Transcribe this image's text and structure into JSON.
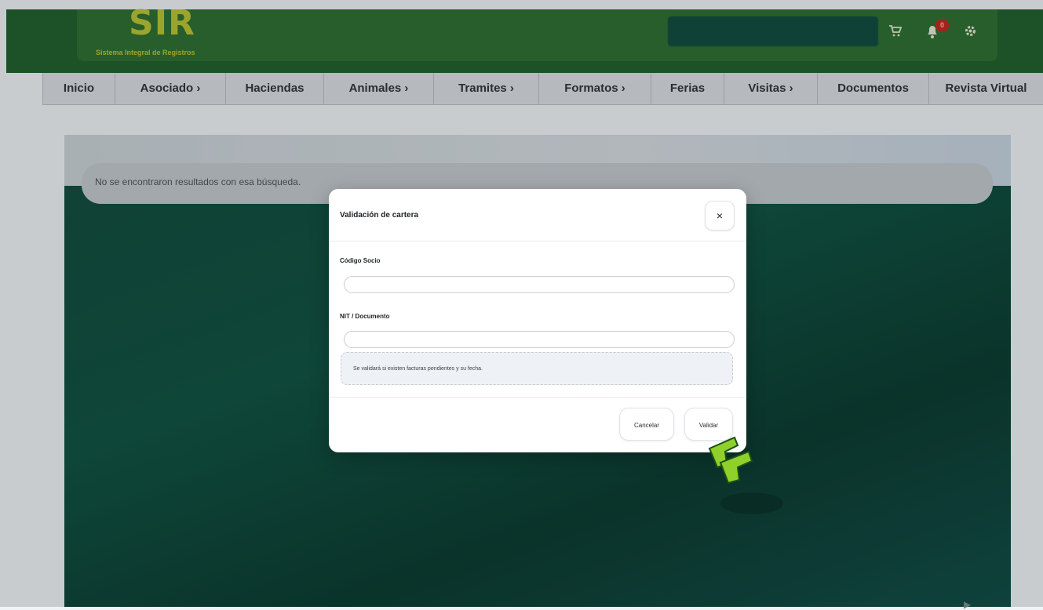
{
  "header": {
    "logo_title": "SIR",
    "logo_subtitle": "Sistema Integral de Registros",
    "notification_count": "0",
    "icons": [
      "cart-icon",
      "bell-icon",
      "gear-icon"
    ]
  },
  "nav": {
    "items": [
      {
        "label": "Inicio"
      },
      {
        "label": "Asociado ›"
      },
      {
        "label": "Haciendas"
      },
      {
        "label": "Animales ›"
      },
      {
        "label": "Tramites ›"
      },
      {
        "label": "Formatos ›"
      },
      {
        "label": "Ferias"
      },
      {
        "label": "Visitas ›"
      },
      {
        "label": "Documentos"
      },
      {
        "label": "Revista Virtual"
      }
    ]
  },
  "main": {
    "no_results_text": "No se encontraron resultados con esa búsqueda."
  },
  "modal": {
    "title": "Validación de cartera",
    "close_symbol": "×",
    "fields": [
      {
        "label": "Código Socio",
        "value": ""
      },
      {
        "label": "NIT / Documento",
        "value": ""
      }
    ],
    "info_text": "Se validará si existen facturas pendientes y su fecha.",
    "cancel_label": "Cancelar",
    "validate_label": "Validar"
  },
  "colors": {
    "header_green": "#2b6e2f",
    "logo_yellow": "#b9c531",
    "content_green": "#0d5140",
    "badge_red": "#c3271d"
  }
}
